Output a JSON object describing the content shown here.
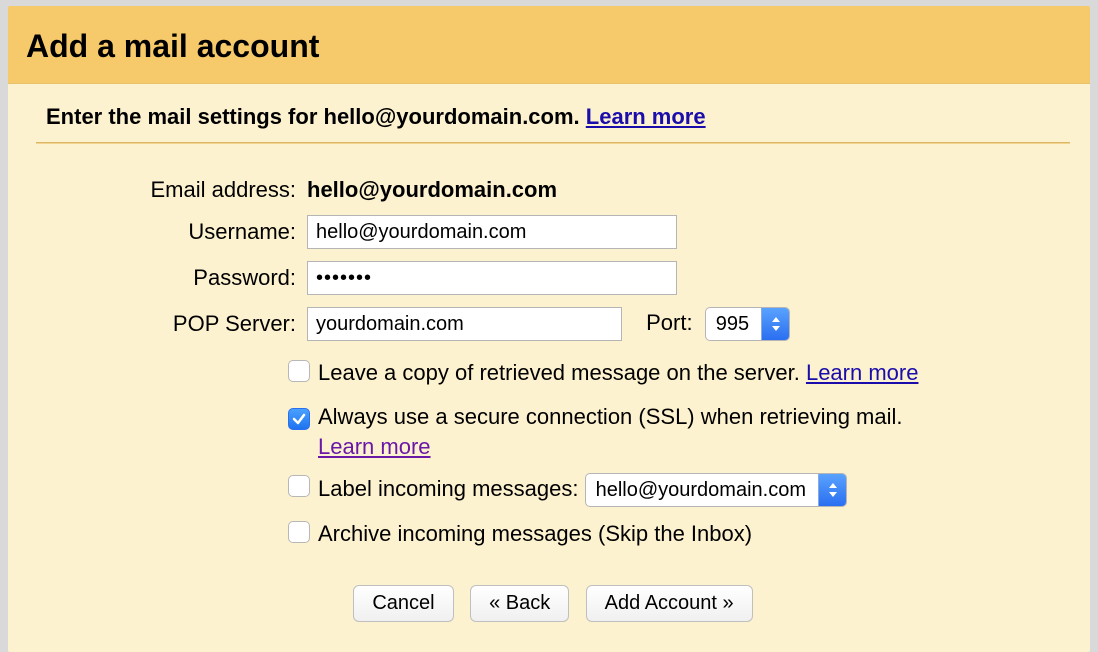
{
  "header": {
    "title": "Add a mail account"
  },
  "subhead": {
    "prefix": "Enter the mail settings for ",
    "email": "hello@yourdomain.com",
    "suffix": ". ",
    "learn_more": "Learn more"
  },
  "form": {
    "email_label": "Email address:",
    "email_value": "hello@yourdomain.com",
    "username_label": "Username:",
    "username_value": "hello@yourdomain.com",
    "password_label": "Password:",
    "password_value": "•••••••",
    "pop_label": "POP Server:",
    "pop_value": "yourdomain.com",
    "port_label": "Port:",
    "port_value": "995"
  },
  "options": {
    "leave_copy": {
      "checked": false,
      "text": "Leave a copy of retrieved message on the server. ",
      "learn_more": "Learn more"
    },
    "ssl": {
      "checked": true,
      "text": "Always use a secure connection (SSL) when retrieving mail. ",
      "learn_more": "Learn more"
    },
    "label_incoming": {
      "checked": false,
      "text": "Label incoming messages: ",
      "select_value": "hello@yourdomain.com"
    },
    "archive": {
      "checked": false,
      "text": "Archive incoming messages (Skip the Inbox)"
    }
  },
  "buttons": {
    "cancel": "Cancel",
    "back": "« Back",
    "add": "Add Account »"
  }
}
